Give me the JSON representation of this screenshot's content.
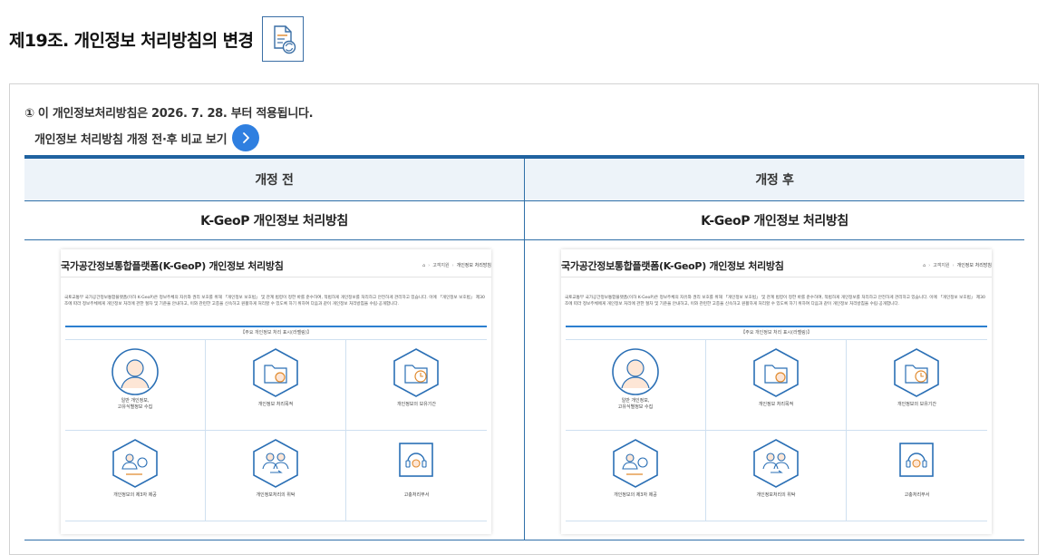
{
  "page": {
    "title": "제19조. 개인정보 처리방침의 변경",
    "title_icon": "document-refresh-icon"
  },
  "notice": {
    "text": "① 이 개인정보처리방침은 2026. 7. 28. 부터 적용됩니다.",
    "compare_label": "개인정보 처리방침 개정 전·후 비교 보기"
  },
  "table": {
    "before_header": "개정 전",
    "after_header": "개정 후",
    "before_subtitle": "K-GeoP 개인정보 처리방침",
    "after_subtitle": "K-GeoP 개인정보 처리방침"
  },
  "doc": {
    "title": "국가공간정보통합플랫폼(K-GeoP) 개인정보 처리방침",
    "breadcrumb": [
      "고객지원",
      "개인정보 처리방침"
    ],
    "intro": "국토교통부 국가공간정보통합플랫폼(이하 K-GeoP)은 정보주체의 자유와 권리 보호를 위해 「개인정보 보호법」 및 관계 법령이 정한 바를 준수하여, 적법하게 개인정보를 처리하고 안전하게 관리하고 있습니다. 이에 「개인정보 보호법」 제30조에 따라 정보주체에게 개인정보 처리에 관한 절차 및 기준을 안내하고, 이와 관련한 고충을 신속하고 원활하게 처리할 수 있도록 하기 위하여 다음과 같이 개인정보 처리방침을 수립·공개합니다.",
    "box_title": "【주요 개인정보 처리 표시(라벨링)】",
    "items": [
      {
        "label": "일반 개인정보,\n고유식별정보 수집",
        "icon": "person-icon"
      },
      {
        "label": "개인정보 처리목적",
        "icon": "folder-gear-icon"
      },
      {
        "label": "개인정보의 보유기간",
        "icon": "folder-clock-icon"
      },
      {
        "label": "개인정보의 제3자 제공",
        "icon": "third-party-icon"
      },
      {
        "label": "개인정보처리의 위탁",
        "icon": "delegation-icon"
      },
      {
        "label": "고충처리부서",
        "icon": "headset-icon"
      }
    ]
  },
  "colors": {
    "accent": "#1f62a0",
    "button": "#2f7fe0",
    "header_bg": "#edf3f9",
    "icon_stroke": "#2a6fb5"
  }
}
